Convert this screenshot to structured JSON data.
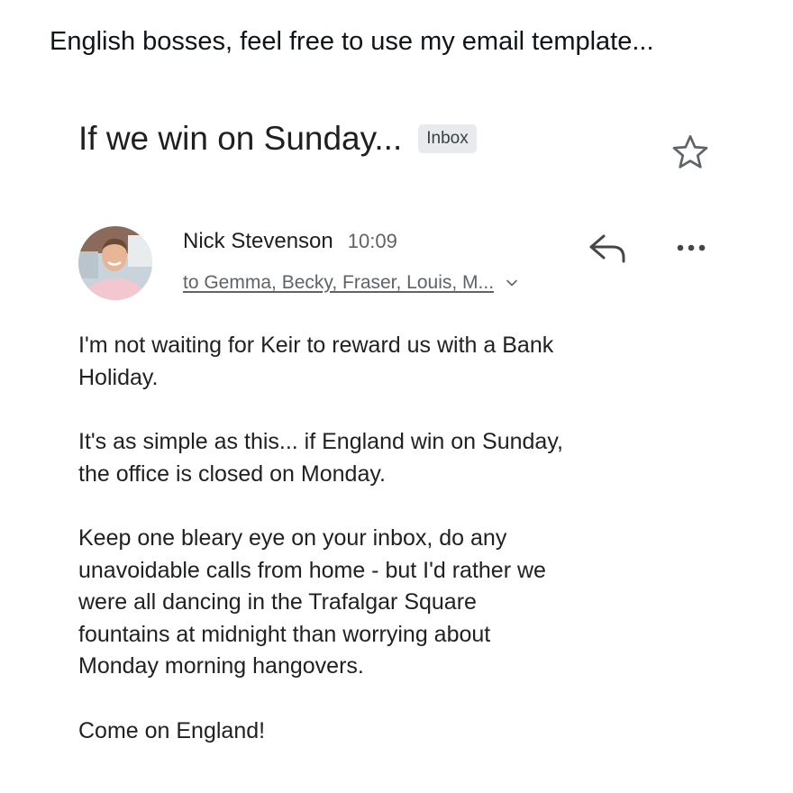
{
  "post": {
    "caption": "English bosses, feel free to use my email template..."
  },
  "email": {
    "subject": "If we win on Sunday...",
    "label_badge": "Inbox",
    "sender_name": "Nick Stevenson",
    "time": "10:09",
    "recipients": "to Gemma, Becky, Fraser, Louis, M...",
    "body": {
      "p1_l1": "I'm not waiting for Keir to reward us with a Bank",
      "p1_l2": "Holiday.",
      "p2_l1": "It's as simple as this... if England win on Sunday,",
      "p2_l2": "the office is closed on Monday.",
      "p3_l1": "Keep one bleary eye on your inbox, do any",
      "p3_l2": "unavoidable calls from home - but I'd rather we",
      "p3_l3": "were all dancing in the Trafalgar Square",
      "p3_l4": "fountains at midnight than worrying about",
      "p3_l5": "Monday morning hangovers.",
      "p4_l1": "Come on England!"
    }
  },
  "icons": {
    "star": "star-outline-icon",
    "reply": "reply-arrow-icon",
    "more": "more-horizontal-icon",
    "chevron": "chevron-down-icon"
  }
}
